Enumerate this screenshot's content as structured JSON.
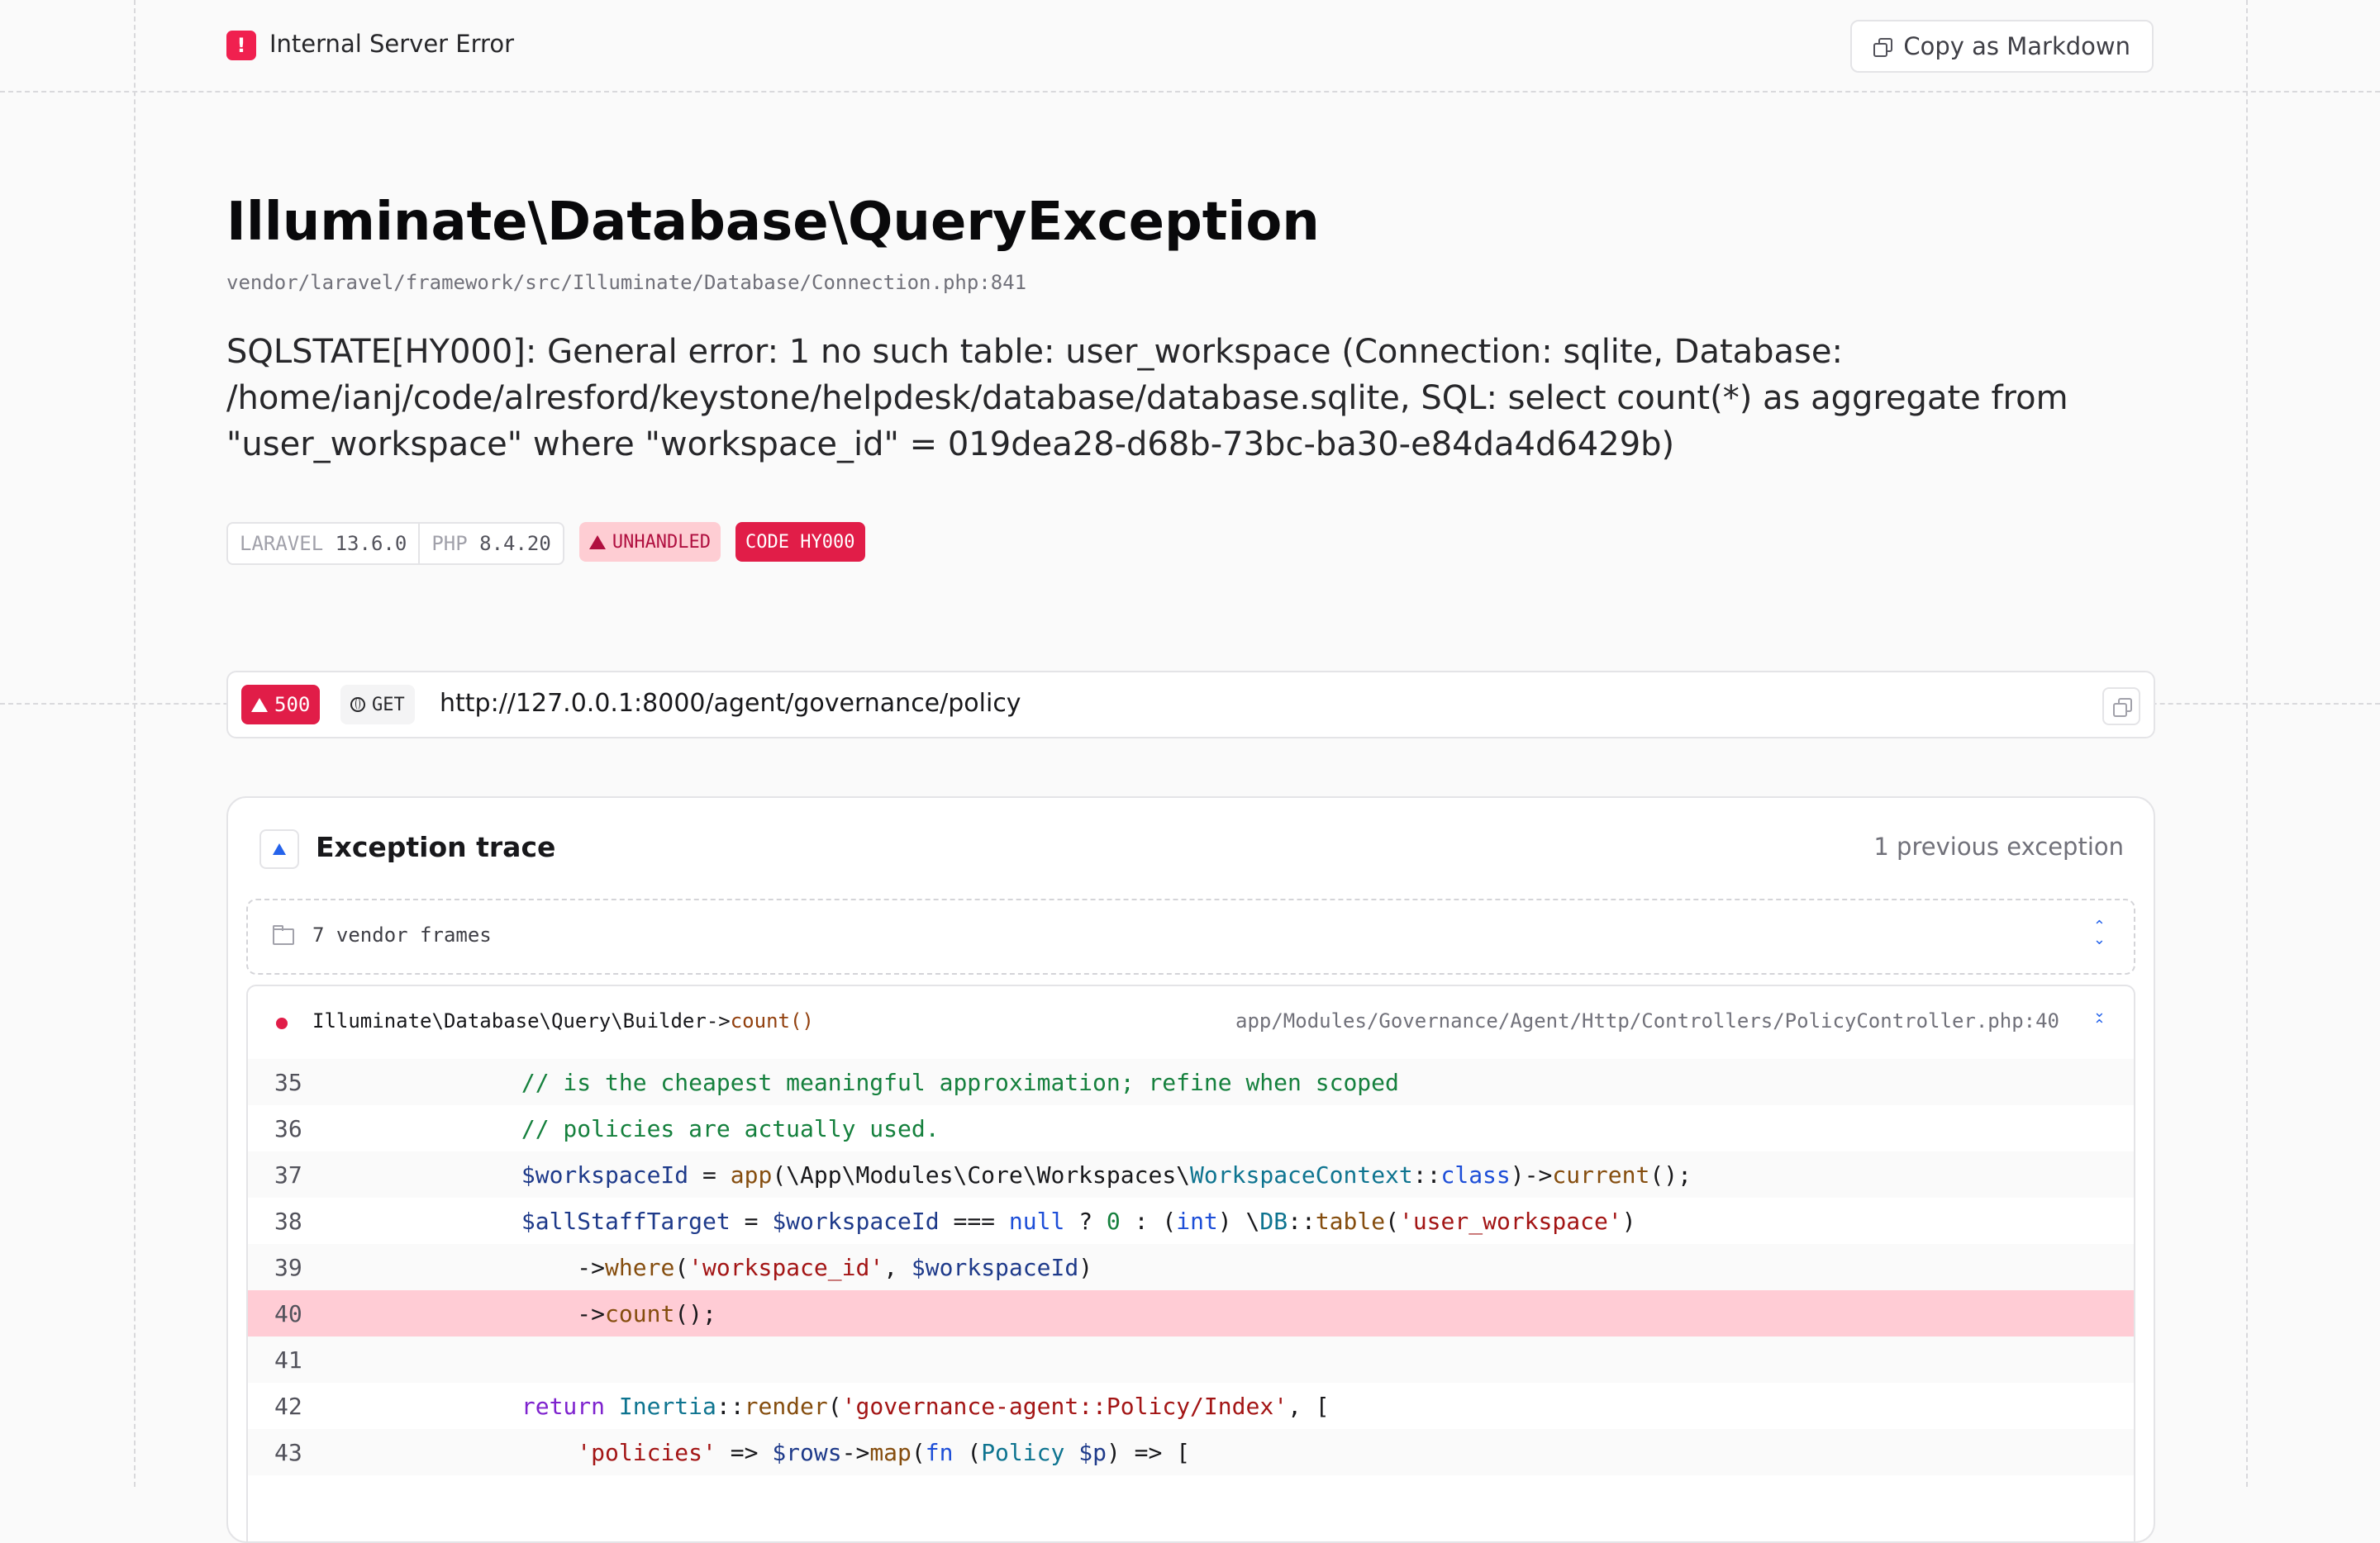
{
  "header": {
    "title": "Internal Server Error",
    "copy_markdown": "Copy as Markdown"
  },
  "exception": {
    "class": "Illuminate\\Database\\QueryException",
    "file": "vendor/laravel/framework/src/Illuminate/Database/Connection.php:841",
    "message": "SQLSTATE[HY000]: General error: 1 no such table: user_workspace (Connection: sqlite, Database: /home/ianj/code/alresford/keystone/helpdesk/database/database.sqlite, SQL: select count(*) as aggregate from \"user_workspace\" where \"workspace_id\" = 019dea28-d68b-73bc-ba30-e84da4d6429b)"
  },
  "badges": {
    "laravel_label": "LARAVEL",
    "laravel_version": "13.6.0",
    "php_label": "PHP",
    "php_version": "8.4.20",
    "unhandled": "UNHANDLED",
    "code": "CODE HY000"
  },
  "request": {
    "status": "500",
    "method": "GET",
    "url": "http://127.0.0.1:8000/agent/governance/policy"
  },
  "trace": {
    "title": "Exception trace",
    "previous": "1 previous exception",
    "vendor_frames": "7 vendor frames",
    "frame": {
      "class": "Illuminate\\Database\\Query\\Builder->",
      "method": "count()",
      "file": "app/Modules/Governance/Agent/Http/Controllers/PolicyController.php:40"
    },
    "line_numbers": [
      "35",
      "36",
      "37",
      "38",
      "39",
      "40",
      "41",
      "42",
      "43"
    ],
    "highlight_line": "40"
  },
  "colors": {
    "error": "#e11d48",
    "highlight": "#ffccd5",
    "accent": "#2563eb"
  }
}
